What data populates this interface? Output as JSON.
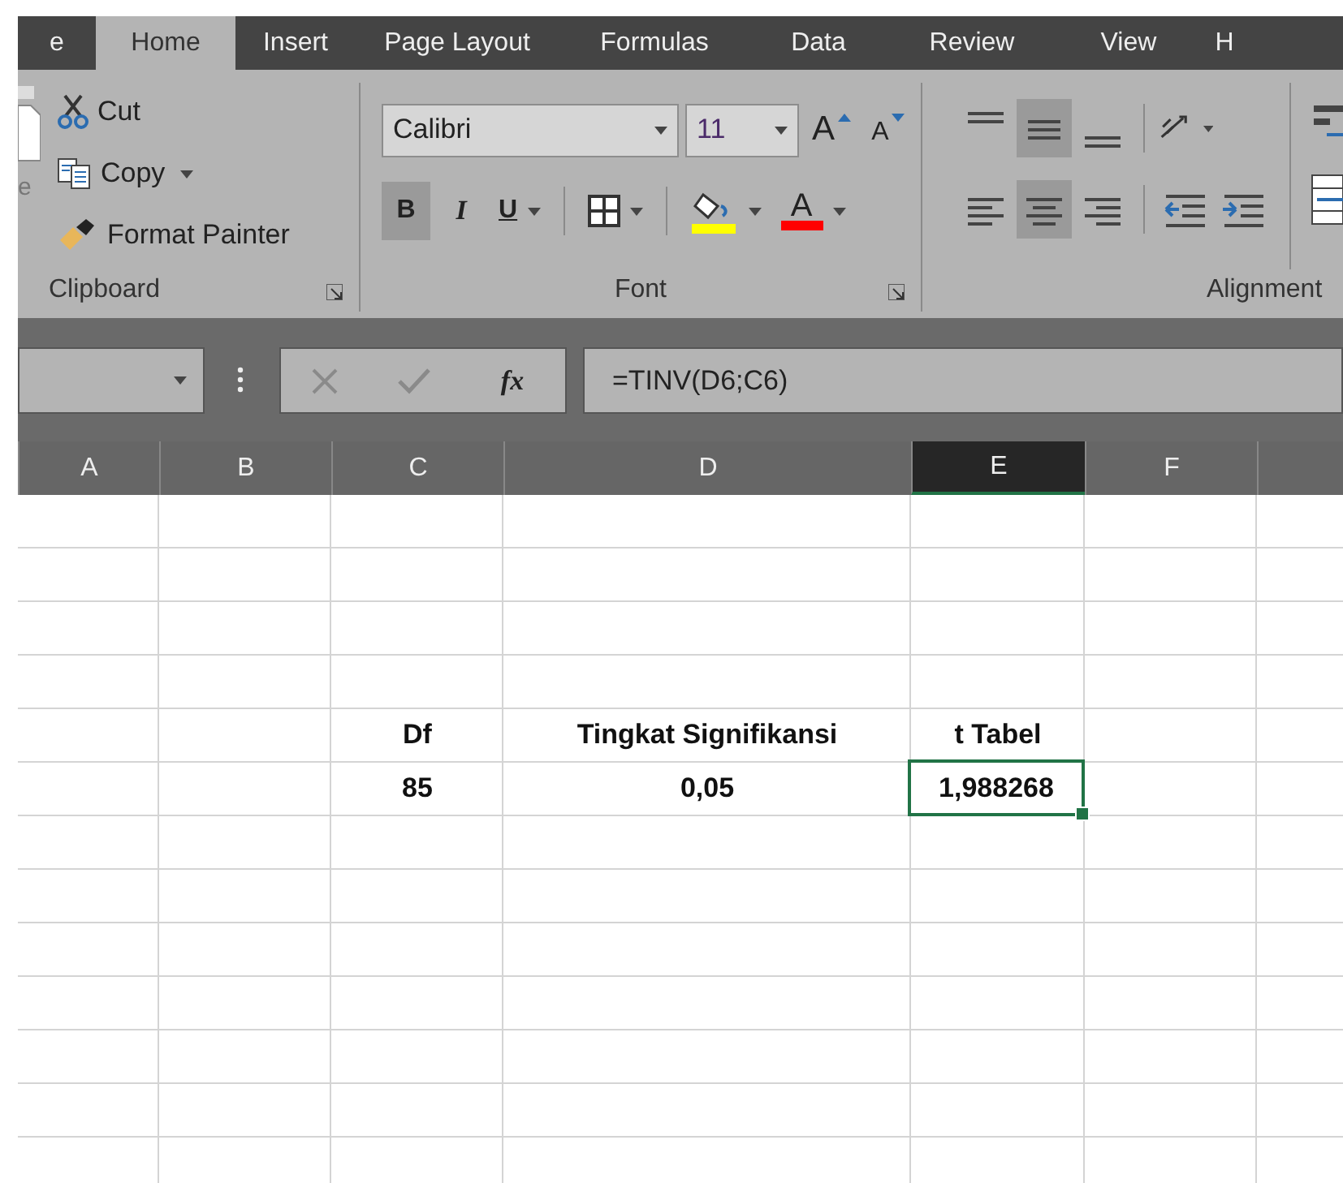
{
  "tabs": [
    {
      "label": "e",
      "selected": false
    },
    {
      "label": "Home",
      "selected": true
    },
    {
      "label": "Insert",
      "selected": false
    },
    {
      "label": "Page Layout",
      "selected": false
    },
    {
      "label": "Formulas",
      "selected": false
    },
    {
      "label": "Data",
      "selected": false
    },
    {
      "label": "Review",
      "selected": false
    },
    {
      "label": "View",
      "selected": false
    },
    {
      "label": "H",
      "selected": false
    }
  ],
  "clipboard": {
    "label": "Clipboard",
    "paste_label": "e",
    "items": [
      {
        "kind": "cut",
        "label": "Cut"
      },
      {
        "kind": "copy",
        "label": "Copy"
      },
      {
        "kind": "format-painter",
        "label": "Format Painter"
      }
    ]
  },
  "font": {
    "label": "Font",
    "font_name": "Calibri",
    "font_size": "11",
    "grow_label": "A",
    "shrink_label": "A",
    "tools": [
      {
        "kind": "bold",
        "label": "B",
        "pressed": true
      },
      {
        "kind": "italic",
        "label": "I",
        "pressed": false
      },
      {
        "kind": "underline",
        "label": "U",
        "pressed": false
      },
      {
        "kind": "borders",
        "pressed": false
      },
      {
        "kind": "fill-color",
        "pressed": false
      },
      {
        "kind": "font-color",
        "label": "A",
        "pressed": false
      }
    ]
  },
  "alignment": {
    "label": "Alignment",
    "row_1": [
      {
        "kind": "align-top",
        "pressed": false
      },
      {
        "kind": "align-middle",
        "pressed": true
      },
      {
        "kind": "align-bottom",
        "pressed": false
      },
      {
        "kind": "orientation",
        "pressed": false
      }
    ],
    "row_2": [
      {
        "kind": "align-left",
        "pressed": false
      },
      {
        "kind": "align-center",
        "pressed": true
      },
      {
        "kind": "align-right",
        "pressed": false
      },
      {
        "kind": "indent-decrease",
        "pressed": false
      },
      {
        "kind": "indent-increase",
        "pressed": false
      }
    ]
  },
  "formula_bar": {
    "fx_label": "fx",
    "formula": "=TINV(D6;C6)"
  },
  "columns": [
    {
      "label": "A",
      "selected": false
    },
    {
      "label": "B",
      "selected": false
    },
    {
      "label": "C",
      "selected": false
    },
    {
      "label": "D",
      "selected": false
    },
    {
      "label": "E",
      "selected": true
    },
    {
      "label": "F",
      "selected": false
    }
  ],
  "rows": [
    {
      "cells": [
        null,
        null,
        {
          "text": "Df",
          "selected": false
        },
        {
          "text": "Tingkat Signifikansi",
          "selected": false
        },
        {
          "text": "t Tabel",
          "selected": false
        },
        null,
        null
      ]
    },
    {
      "cells": [
        null,
        null,
        {
          "text": "85",
          "selected": false
        },
        {
          "text": "0,05",
          "selected": false
        },
        {
          "text": "1,988268",
          "selected": true
        },
        null,
        null
      ]
    }
  ]
}
